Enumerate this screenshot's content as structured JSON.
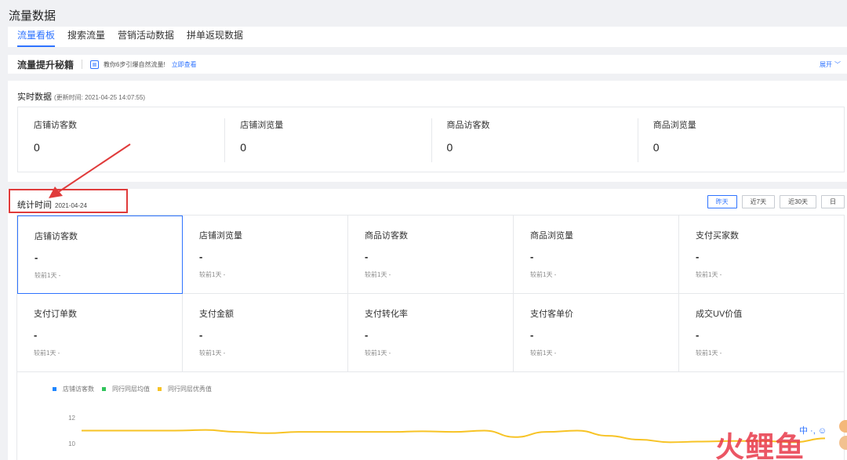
{
  "page": {
    "title": "流量数据"
  },
  "tabs": [
    {
      "label": "流量看板",
      "active": true
    },
    {
      "label": "搜索流量",
      "active": false
    },
    {
      "label": "营销活动数据",
      "active": false
    },
    {
      "label": "拼单返现数据",
      "active": false
    }
  ],
  "promo": {
    "title": "流量提升秘籍",
    "text": "教你6步引爆自然流量!",
    "link": "立即查看",
    "expand": "展开"
  },
  "realtime": {
    "title": "实时数据",
    "update": "(更新时间: 2021-04-25 14:07:55)",
    "metrics": [
      {
        "label": "店铺访客数",
        "value": "0"
      },
      {
        "label": "店铺浏览量",
        "value": "0"
      },
      {
        "label": "商品访客数",
        "value": "0"
      },
      {
        "label": "商品浏览量",
        "value": "0"
      }
    ]
  },
  "stats": {
    "title": "统计时间",
    "date": "2021-04-24",
    "ranges": [
      {
        "label": "昨天",
        "active": true
      },
      {
        "label": "近7天",
        "active": false
      },
      {
        "label": "近30天",
        "active": false
      },
      {
        "label": "日",
        "active": false
      }
    ],
    "metrics": [
      {
        "label": "店铺访客数",
        "value": "-",
        "compare": "较前1天  -"
      },
      {
        "label": "店铺浏览量",
        "value": "-",
        "compare": "较前1天  -"
      },
      {
        "label": "商品访客数",
        "value": "-",
        "compare": "较前1天  -"
      },
      {
        "label": "商品浏览量",
        "value": "-",
        "compare": "较前1天  -"
      },
      {
        "label": "支付买家数",
        "value": "-",
        "compare": "较前1天  -"
      },
      {
        "label": "支付订单数",
        "value": "-",
        "compare": "较前1天  -"
      },
      {
        "label": "支付金额",
        "value": "-",
        "compare": "较前1天  -"
      },
      {
        "label": "支付转化率",
        "value": "-",
        "compare": "较前1天  -"
      },
      {
        "label": "支付客单价",
        "value": "-",
        "compare": "较前1天  -"
      },
      {
        "label": "成交UV价值",
        "value": "-",
        "compare": "较前1天  -"
      }
    ]
  },
  "chart_data": {
    "type": "line",
    "yticks": [
      "12",
      "10"
    ],
    "legend": [
      {
        "name": "店铺访客数",
        "color": "#1f86ff"
      },
      {
        "name": "同行同层均值",
        "color": "#31c45b"
      },
      {
        "name": "同行同层优秀值",
        "color": "#f7c325"
      }
    ],
    "series": [
      {
        "name": "同行同层优秀值",
        "color": "#f7c325",
        "values": [
          11.0,
          11.0,
          11.0,
          11.0,
          11.05,
          10.9,
          10.8,
          10.9,
          10.9,
          10.9,
          10.9,
          10.95,
          10.9,
          11.0,
          10.5,
          10.9,
          11.0,
          10.6,
          10.3,
          10.1,
          10.15,
          10.2,
          10.2,
          10.1,
          10.4
        ]
      }
    ]
  },
  "watermark": {
    "text": "火鲤鱼"
  },
  "ime": {
    "text": "中 ·, ☺"
  }
}
